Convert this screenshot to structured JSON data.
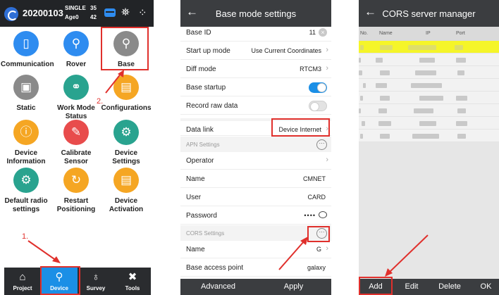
{
  "panel1": {
    "status": {
      "title": "20200103",
      "solution": "SINGLE",
      "age": "Age0",
      "satellites_top": "35",
      "satellites_bottom": "42"
    },
    "grid": [
      {
        "label": "Communication",
        "icon": "phone-icon",
        "color": "#2e8cf0",
        "glyph": "▯"
      },
      {
        "label": "Rover",
        "icon": "rover-receiver-icon",
        "color": "#2e8cf0",
        "glyph": "⚲"
      },
      {
        "label": "Base",
        "icon": "base-receiver-icon",
        "color": "#8a8a8a",
        "glyph": "⚲"
      },
      {
        "label": "Static",
        "icon": "static-receiver-icon",
        "color": "#8a8a8a",
        "glyph": "▣"
      },
      {
        "label": "Work Mode Status",
        "icon": "work-mode-icon",
        "color": "#29a38f",
        "glyph": "⚭"
      },
      {
        "label": "Configurations",
        "icon": "configurations-icon",
        "color": "#f5a623",
        "glyph": "▤"
      },
      {
        "label": "Device Information",
        "icon": "device-info-icon",
        "color": "#f5a623",
        "glyph": "ⓘ"
      },
      {
        "label": "Calibrate Sensor",
        "icon": "calibrate-sensor-icon",
        "color": "#e84c4c",
        "glyph": "✎"
      },
      {
        "label": "Device Settings",
        "icon": "device-settings-icon",
        "color": "#29a38f",
        "glyph": "⚙"
      },
      {
        "label": "Default radio settings",
        "icon": "radio-settings-icon",
        "color": "#29a38f",
        "glyph": "⚙"
      },
      {
        "label": "Restart Positioning",
        "icon": "restart-positioning-icon",
        "color": "#f5a623",
        "glyph": "↻"
      },
      {
        "label": "Device Activation",
        "icon": "device-activation-icon",
        "color": "#f5a623",
        "glyph": "▤"
      }
    ],
    "bottom_tabs": [
      {
        "label": "Project",
        "icon": "project-icon",
        "glyph": "⌂"
      },
      {
        "label": "Device",
        "icon": "device-icon",
        "glyph": "⚲"
      },
      {
        "label": "Survey",
        "icon": "survey-icon",
        "glyph": "♁"
      },
      {
        "label": "Tools",
        "icon": "tools-icon",
        "glyph": "✖"
      }
    ],
    "step1": "1.",
    "step2": "2."
  },
  "panel2": {
    "title": "Base mode settings",
    "rows": [
      {
        "label": "Base ID",
        "value": "11",
        "kind": "clear"
      },
      {
        "label": "Start up mode",
        "value": "Use Current Coordinates",
        "kind": "chev"
      },
      {
        "label": "Diff mode",
        "value": "RTCM3",
        "kind": "chev"
      },
      {
        "label": "Base startup",
        "value": "",
        "kind": "toggle-on"
      },
      {
        "label": "Record raw data",
        "value": "",
        "kind": "toggle-off"
      },
      {
        "label": "Data link",
        "value": "Device Internet",
        "kind": "chev"
      },
      {
        "label": "APN Settings",
        "value": "",
        "kind": "section"
      },
      {
        "label": "Operator",
        "value": "",
        "kind": "chev"
      },
      {
        "label": "Name",
        "value": "CMNET",
        "kind": "plain"
      },
      {
        "label": "User",
        "value": "CARD",
        "kind": "plain"
      },
      {
        "label": "Password",
        "value": "••••",
        "kind": "eye"
      },
      {
        "label": "CORS Settings",
        "value": "",
        "kind": "section"
      },
      {
        "label": "Name",
        "value": "G",
        "kind": "chev"
      },
      {
        "label": "Base access point",
        "value": "galaxy",
        "kind": "plain"
      }
    ],
    "advanced": "Advanced",
    "apply": "Apply",
    "more": "···"
  },
  "panel3": {
    "title": "CORS server manager",
    "headers": [
      "No.",
      "Name",
      "IP",
      "Port"
    ],
    "buttons": [
      "Add",
      "Edit",
      "Delete",
      "OK"
    ]
  },
  "colors": {
    "accent_blue": "#1b8fe6",
    "highlight_red": "#e0302c",
    "toggle_on": "#1b8fe6",
    "selected_row": "#f5f529"
  }
}
